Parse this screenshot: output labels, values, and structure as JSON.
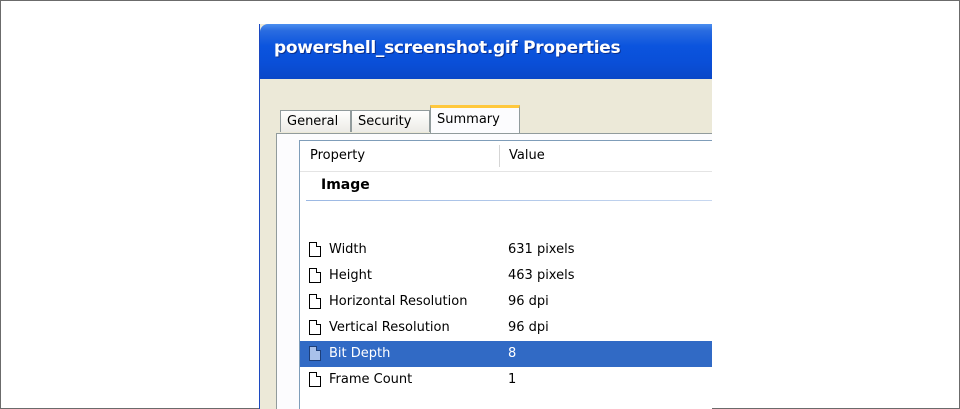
{
  "window": {
    "title": "powershell_screenshot.gif Properties"
  },
  "tabs": [
    {
      "label": "General",
      "active": false
    },
    {
      "label": "Security",
      "active": false
    },
    {
      "label": "Summary",
      "active": true
    }
  ],
  "list": {
    "columns": {
      "property": "Property",
      "value": "Value"
    },
    "group": "Image",
    "rows": [
      {
        "property": "Width",
        "value": "631 pixels",
        "selected": false
      },
      {
        "property": "Height",
        "value": "463 pixels",
        "selected": false
      },
      {
        "property": "Horizontal Resolution",
        "value": "96 dpi",
        "selected": false
      },
      {
        "property": "Vertical Resolution",
        "value": "96 dpi",
        "selected": false
      },
      {
        "property": "Bit Depth",
        "value": "8",
        "selected": true
      },
      {
        "property": "Frame Count",
        "value": "1",
        "selected": false
      }
    ]
  },
  "colors": {
    "title_bar": "#0a4fd8",
    "selection": "#316ac5",
    "active_tab_accent": "#ffc83c"
  }
}
